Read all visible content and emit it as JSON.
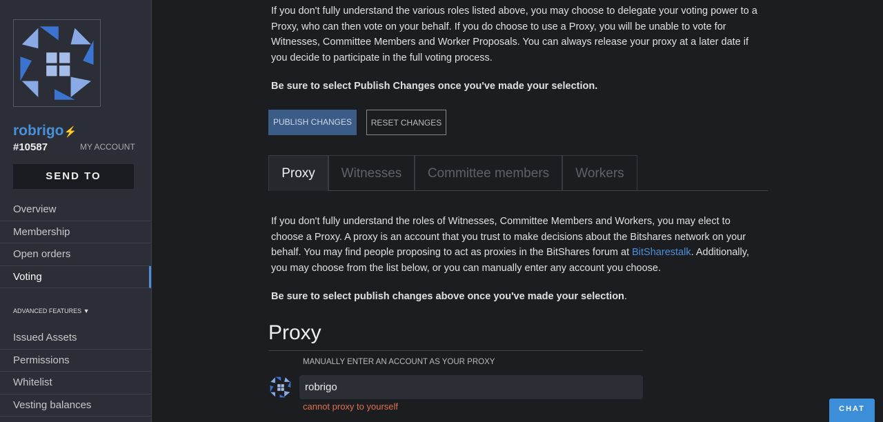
{
  "sidebar": {
    "username": "robrigo",
    "account_id": "#10587",
    "my_account": "MY ACCOUNT",
    "send_to": "SEND TO",
    "items": [
      "Overview",
      "Membership",
      "Open orders",
      "Voting"
    ],
    "advanced": "ADVANCED FEATURES ▼",
    "advanced_items": [
      "Issued Assets",
      "Permissions",
      "Whitelist",
      "Vesting balances"
    ]
  },
  "main": {
    "intro": "If you don't fully understand the various roles listed above, you may choose to delegate your voting power to a Proxy, who can then vote on your behalf. If you do choose to use a Proxy, you will be unable to vote for Witnesses, Committee Members and Worker Proposals. You can always release your proxy at a later date if you decide to participate in the full voting process.",
    "notice": "Be sure to select Publish Changes once you've made your selection.",
    "publish": "PUBLISH CHANGES",
    "reset": "RESET CHANGES",
    "tabs": [
      "Proxy",
      "Witnesses",
      "Committee members",
      "Workers"
    ],
    "desc_1": "If you don't fully understand the roles of Witnesses, Committee Members and Workers, you may elect to choose a Proxy. A proxy is an account that you trust to make decisions about the Bitshares network on your behalf. You may find people proposing to act as proxies in the BitShares forum at ",
    "link": "BitSharestalk",
    "desc_2": ". Additionally, you may choose from the list below, or you can manually enter any account you choose.",
    "notice_2": "Be sure to select publish changes above once you've made your selection",
    "notice_2_end": ".",
    "proxy_heading": "Proxy",
    "proxy_label": "MANUALLY ENTER AN ACCOUNT AS YOUR PROXY",
    "proxy_value": "robrigo",
    "proxy_error": "cannot proxy to yourself"
  },
  "chat": "CHAT",
  "colors": {
    "accent": "#4a90d9",
    "error": "#e0704a"
  }
}
